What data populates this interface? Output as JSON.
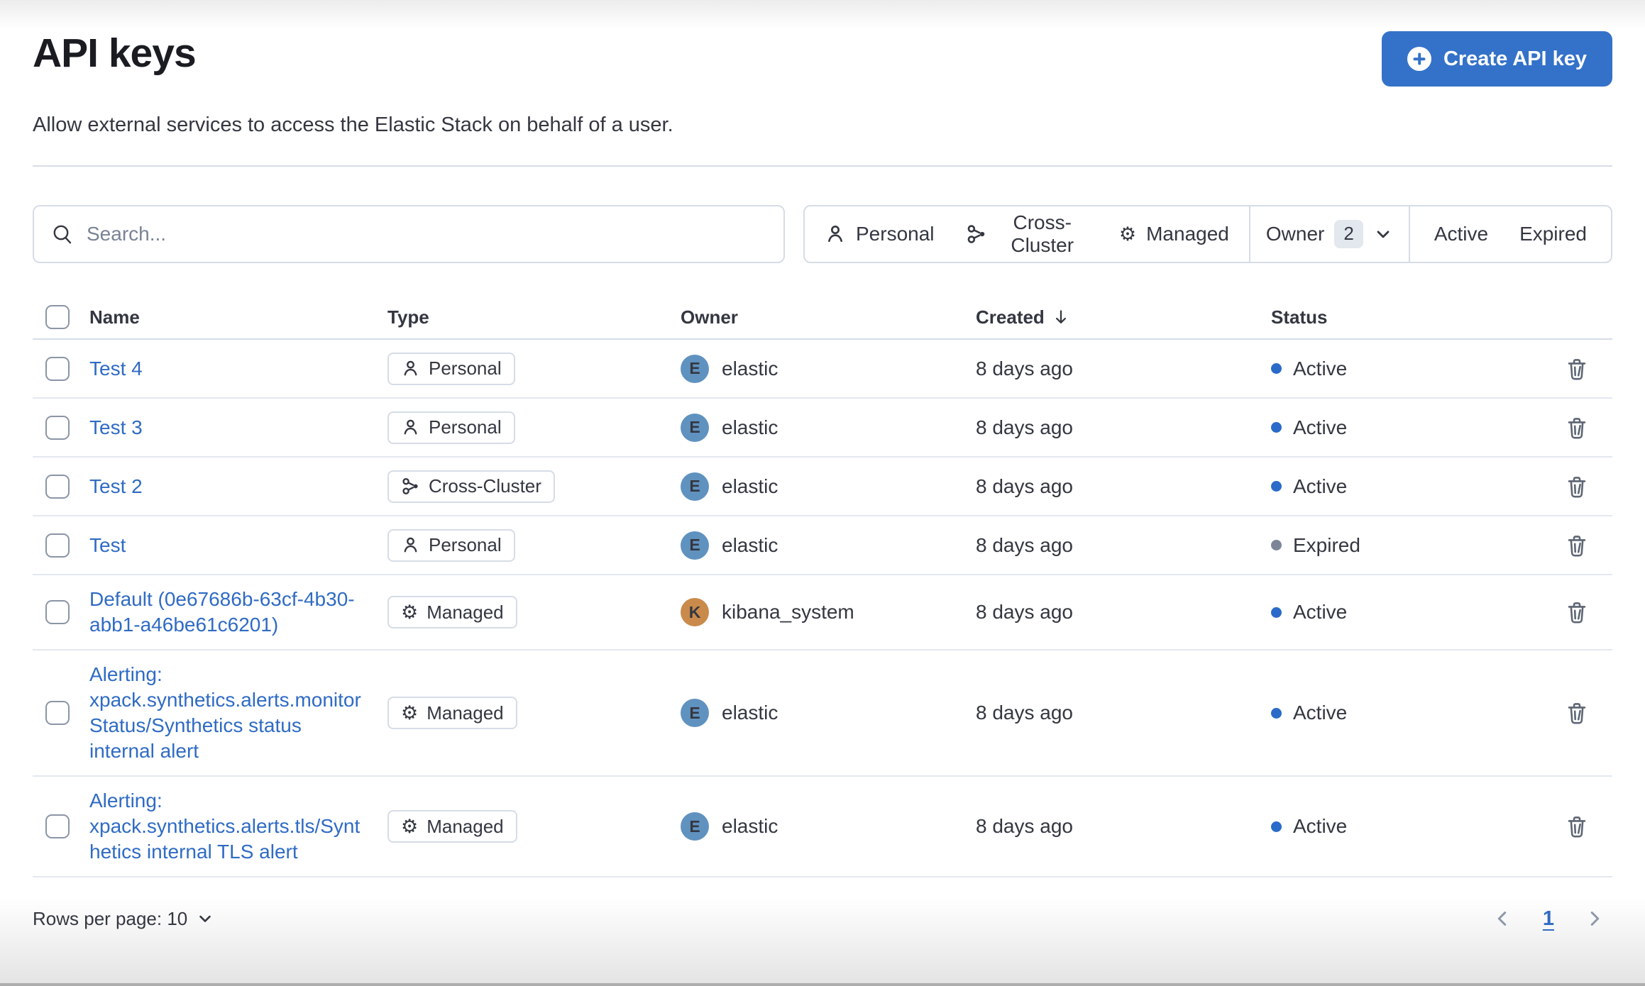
{
  "page": {
    "title": "API keys",
    "subtitle": "Allow external services to access the Elastic Stack on behalf of a user."
  },
  "header": {
    "create_button": "Create API key"
  },
  "toolbar": {
    "search_placeholder": "Search...",
    "filters": {
      "personal": "Personal",
      "cross_cluster": "Cross-Cluster",
      "managed": "Managed",
      "owner": "Owner",
      "owner_count": "2",
      "active": "Active",
      "expired": "Expired"
    }
  },
  "table": {
    "headers": {
      "name": "Name",
      "type": "Type",
      "owner": "Owner",
      "created": "Created",
      "status": "Status"
    },
    "rows": [
      {
        "name": "Test 4",
        "type": "Personal",
        "type_icon": "user-icon",
        "owner": "elastic",
        "owner_initial": "E",
        "created": "8 days ago",
        "status": "Active"
      },
      {
        "name": "Test 3",
        "type": "Personal",
        "type_icon": "user-icon",
        "owner": "elastic",
        "owner_initial": "E",
        "created": "8 days ago",
        "status": "Active"
      },
      {
        "name": "Test 2",
        "type": "Cross-Cluster",
        "type_icon": "cluster-icon",
        "owner": "elastic",
        "owner_initial": "E",
        "created": "8 days ago",
        "status": "Active"
      },
      {
        "name": "Test",
        "type": "Personal",
        "type_icon": "user-icon",
        "owner": "elastic",
        "owner_initial": "E",
        "created": "8 days ago",
        "status": "Expired"
      },
      {
        "name": "Default (0e67686b-63cf-4b30-abb1-a46be61c6201)",
        "type": "Managed",
        "type_icon": "gear-icon",
        "owner": "kibana_system",
        "owner_initial": "K",
        "created": "8 days ago",
        "status": "Active"
      },
      {
        "name": "Alerting: xpack.synthetics.alerts.monitorStatus/Synthetics status internal alert",
        "type": "Managed",
        "type_icon": "gear-icon",
        "owner": "elastic",
        "owner_initial": "E",
        "created": "8 days ago",
        "status": "Active"
      },
      {
        "name": "Alerting: xpack.synthetics.alerts.tls/Synthetics internal TLS alert",
        "type": "Managed",
        "type_icon": "gear-icon",
        "owner": "elastic",
        "owner_initial": "E",
        "created": "8 days ago",
        "status": "Active"
      }
    ]
  },
  "pagination": {
    "rows_per_page_label": "Rows per page: 10",
    "current_page": "1"
  },
  "colors": {
    "primary_button": "#3472c9",
    "link": "#2f6bc4",
    "status_active": "#2a6bc9",
    "status_expired": "#7d8698",
    "avatar_elastic": "#6092c0",
    "avatar_kibana_system": "#c98a4b",
    "border": "#d6dce7"
  }
}
